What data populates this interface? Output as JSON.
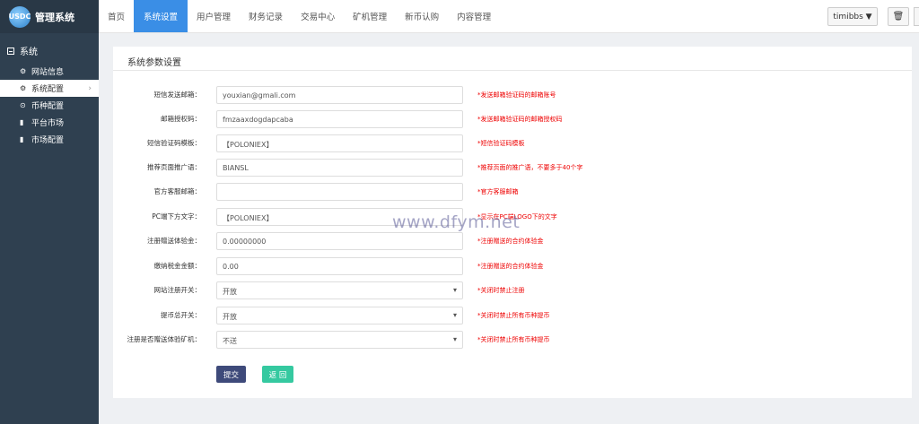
{
  "sidebar": {
    "logo_mark": "USDC",
    "logo_text": "管理系统",
    "section": "系统",
    "items": [
      {
        "label": "网站信息",
        "icon": "gear-icon"
      },
      {
        "label": "系统配置",
        "icon": "gear-icon"
      },
      {
        "label": "币种配置",
        "icon": "coin-icon"
      },
      {
        "label": "平台市场",
        "icon": "bar-chart-icon"
      },
      {
        "label": "市场配置",
        "icon": "bar-chart-icon"
      }
    ]
  },
  "topnav": {
    "tabs": [
      "首页",
      "系统设置",
      "用户管理",
      "财务记录",
      "交易中心",
      "矿机管理",
      "新币认购",
      "内容管理"
    ],
    "active_tab": "系统设置",
    "user": "timibbs ▼",
    "trash_icon": "trash-icon"
  },
  "panel": {
    "title": "系统参数设置",
    "rows": [
      {
        "label": "短信发送邮箱：",
        "value": "youxian@gmali.com",
        "hint": "*发送邮箱验证码的邮箱账号"
      },
      {
        "label": "邮箱授权码：",
        "value": "fmzaaxdogdapcaba",
        "hint": "*发送邮箱验证码的邮箱授权码"
      },
      {
        "label": "短信验证码模板：",
        "value": "【POLONIEX】",
        "hint": "*短信验证码模板"
      },
      {
        "label": "推荐页面推广语：",
        "value": "BIANSL",
        "hint": "*推荐页面的推广语，不要多于40个字"
      },
      {
        "label": "官方客服邮箱：",
        "value": "",
        "hint": "*官方客服邮箱"
      },
      {
        "label": "PC端下方文字：",
        "value": "【POLONIEX】",
        "hint": "*显示在PC端LOGO下的文字"
      },
      {
        "label": "注册赠送体验金：",
        "value": "0.00000000",
        "hint": "*注册赠送的合约体验金"
      },
      {
        "label": "缴纳税金金额：",
        "value": "0.00",
        "hint": "*注册赠送的合约体验金"
      },
      {
        "label": "网站注册开关：",
        "value": "开放",
        "hint": "*关闭时禁止注册",
        "select": true
      },
      {
        "label": "提币总开关：",
        "value": "开放",
        "hint": "*关闭时禁止所有币种提币",
        "select": true
      },
      {
        "label": "注册是否赠送体验矿机：",
        "value": "不送",
        "hint": "*关闭时禁止所有币种提币",
        "select": true
      }
    ],
    "submit": "提交",
    "back": "返 回"
  },
  "watermark": "www.dfym.net"
}
